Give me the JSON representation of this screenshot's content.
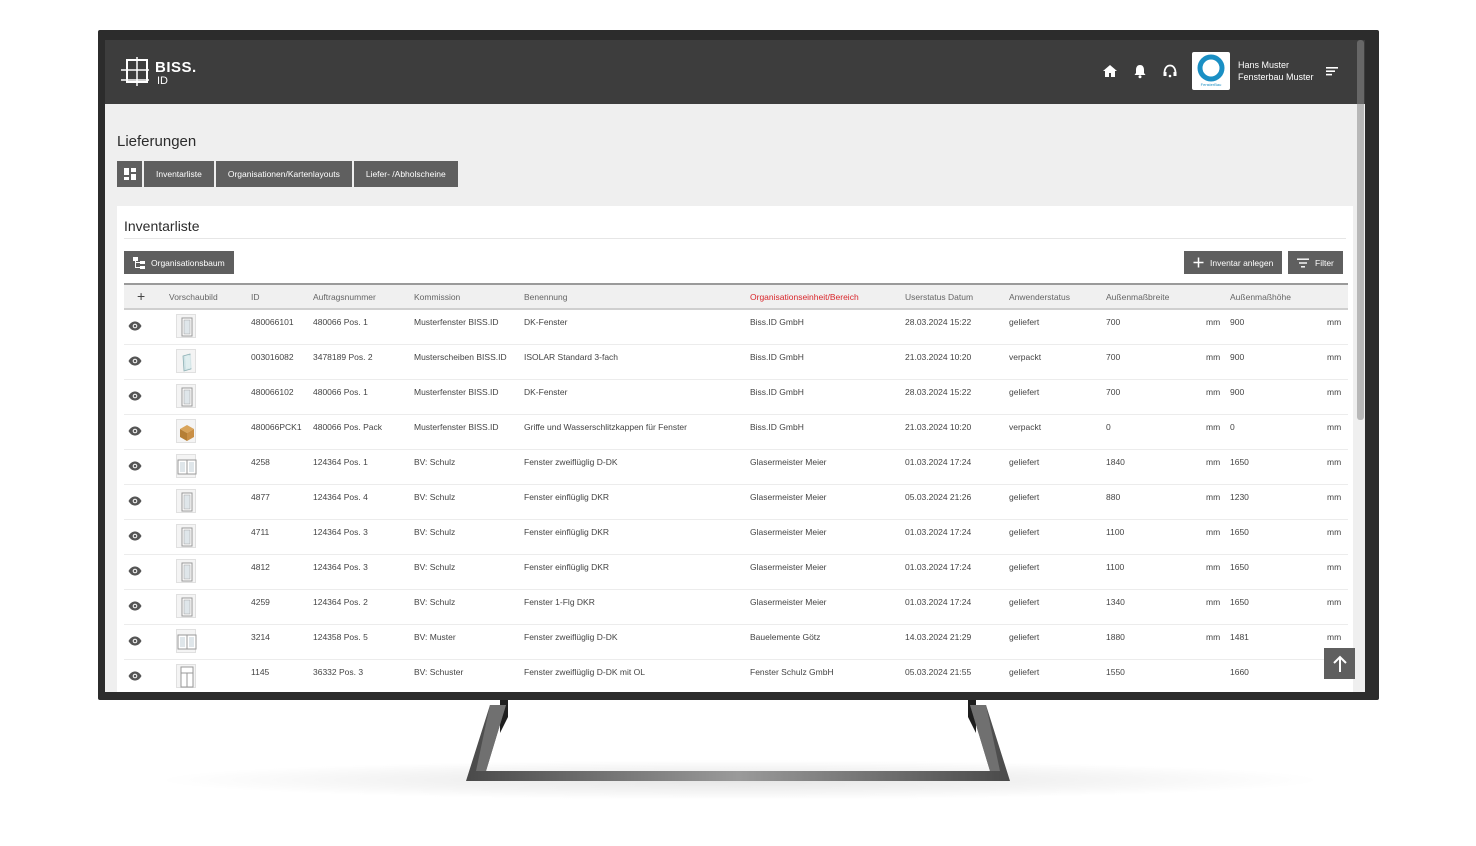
{
  "header": {
    "logo_main": "BISS.",
    "logo_sub": "ID",
    "icons": [
      "home-icon",
      "bell-icon",
      "support-icon",
      "menu-icon"
    ],
    "org_logo_text": "FensterBau",
    "user_name": "Hans Muster",
    "user_org": "Fensterbau Muster"
  },
  "page": {
    "title": "Lieferungen",
    "tabs": [
      "Inventarliste",
      "Organisationen/Kartenlayouts",
      "Liefer- /Abholscheine"
    ]
  },
  "card": {
    "title": "Inventarliste",
    "org_button": "Organisationsbaum",
    "add_button": "Inventar anlegen",
    "filter_button": "Filter"
  },
  "table": {
    "columns": [
      "Vorschaubild",
      "ID",
      "Auftragsnummer",
      "Kommission",
      "Benennung",
      "Organisationseinheit/Bereich",
      "Userstatus Datum",
      "Anwenderstatus",
      "Außenmaßbreite",
      "Außenmaßhöhe"
    ],
    "rows": [
      {
        "thumb": "window-single",
        "id": "480066101",
        "auftrag": "480066 Pos. 1",
        "kommission": "Musterfenster BISS.ID",
        "benennung": "DK-Fenster",
        "org": "Biss.ID GmbH",
        "datum": "28.03.2024 15:22",
        "status": "geliefert",
        "breite": "700",
        "hoehe": "900",
        "unit": "mm"
      },
      {
        "thumb": "glass-pane",
        "id": "003016082",
        "auftrag": "3478189 Pos. 2",
        "kommission": "Musterscheiben BISS.ID",
        "benennung": "ISOLAR Standard 3-fach",
        "org": "Biss.ID GmbH",
        "datum": "21.03.2024 10:20",
        "status": "verpackt",
        "breite": "700",
        "hoehe": "900",
        "unit": "mm"
      },
      {
        "thumb": "window-single",
        "id": "480066102",
        "auftrag": "480066 Pos. 1",
        "kommission": "Musterfenster BISS.ID",
        "benennung": "DK-Fenster",
        "org": "Biss.ID GmbH",
        "datum": "28.03.2024 15:22",
        "status": "geliefert",
        "breite": "700",
        "hoehe": "900",
        "unit": "mm"
      },
      {
        "thumb": "package-box",
        "id": "480066PCK1",
        "auftrag": "480066 Pos. Pack",
        "kommission": "Musterfenster BISS.ID",
        "benennung": "Griffe und Wasserschlitzkappen für Fenster",
        "org": "Biss.ID GmbH",
        "datum": "21.03.2024 10:20",
        "status": "verpackt",
        "breite": "0",
        "hoehe": "0",
        "unit": "mm"
      },
      {
        "thumb": "window-double",
        "id": "4258",
        "auftrag": "124364 Pos. 1",
        "kommission": "BV: Schulz",
        "benennung": "Fenster zweiflüglig D-DK",
        "org": "Glasermeister Meier",
        "datum": "01.03.2024 17:24",
        "status": "geliefert",
        "breite": "1840",
        "hoehe": "1650",
        "unit": "mm"
      },
      {
        "thumb": "window-single",
        "id": "4877",
        "auftrag": "124364 Pos. 4",
        "kommission": "BV: Schulz",
        "benennung": "Fenster einflüglig DKR",
        "org": "Glasermeister Meier",
        "datum": "05.03.2024 21:26",
        "status": "geliefert",
        "breite": "880",
        "hoehe": "1230",
        "unit": "mm"
      },
      {
        "thumb": "window-single",
        "id": "4711",
        "auftrag": "124364 Pos. 3",
        "kommission": "BV: Schulz",
        "benennung": "Fenster einflüglig DKR",
        "org": "Glasermeister Meier",
        "datum": "01.03.2024 17:24",
        "status": "geliefert",
        "breite": "1100",
        "hoehe": "1650",
        "unit": "mm"
      },
      {
        "thumb": "window-single",
        "id": "4812",
        "auftrag": "124364 Pos. 3",
        "kommission": "BV: Schulz",
        "benennung": "Fenster einflüglig DKR",
        "org": "Glasermeister Meier",
        "datum": "01.03.2024 17:24",
        "status": "geliefert",
        "breite": "1100",
        "hoehe": "1650",
        "unit": "mm"
      },
      {
        "thumb": "window-single",
        "id": "4259",
        "auftrag": "124364 Pos. 2",
        "kommission": "BV: Schulz",
        "benennung": "Fenster 1-Flg DKR",
        "org": "Glasermeister Meier",
        "datum": "01.03.2024 17:24",
        "status": "geliefert",
        "breite": "1340",
        "hoehe": "1650",
        "unit": "mm"
      },
      {
        "thumb": "window-double",
        "id": "3214",
        "auftrag": "124358 Pos. 5",
        "kommission": "BV: Muster",
        "benennung": "Fenster zweiflüglig D-DK",
        "org": "Bauelemente Götz",
        "datum": "14.03.2024 21:29",
        "status": "geliefert",
        "breite": "1880",
        "hoehe": "1481",
        "unit": "mm"
      },
      {
        "thumb": "window-transom",
        "id": "1145",
        "auftrag": "36332 Pos. 3",
        "kommission": "BV: Schuster",
        "benennung": "Fenster zweiflüglig D-DK mit OL",
        "org": "Fenster Schulz GmbH",
        "datum": "05.03.2024 21:55",
        "status": "geliefert",
        "breite": "1550",
        "hoehe": "1660",
        "unit": ""
      }
    ]
  },
  "colors": {
    "header_bg": "#3d3d3d",
    "button_bg": "#5f5f5f",
    "active_column": "#d9262b",
    "org_logo_accent": "#1a8fc4"
  }
}
